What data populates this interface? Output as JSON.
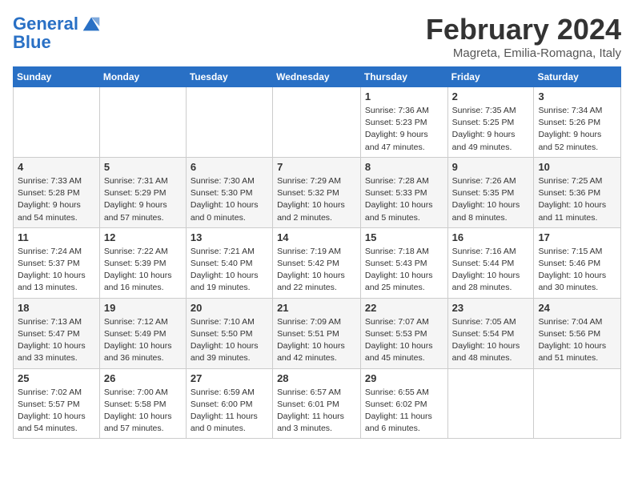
{
  "header": {
    "logo_general": "General",
    "logo_blue": "Blue",
    "month_title": "February 2024",
    "subtitle": "Magreta, Emilia-Romagna, Italy"
  },
  "columns": [
    "Sunday",
    "Monday",
    "Tuesday",
    "Wednesday",
    "Thursday",
    "Friday",
    "Saturday"
  ],
  "weeks": [
    [
      {
        "day": "",
        "info": ""
      },
      {
        "day": "",
        "info": ""
      },
      {
        "day": "",
        "info": ""
      },
      {
        "day": "",
        "info": ""
      },
      {
        "day": "1",
        "info": "Sunrise: 7:36 AM\nSunset: 5:23 PM\nDaylight: 9 hours\nand 47 minutes."
      },
      {
        "day": "2",
        "info": "Sunrise: 7:35 AM\nSunset: 5:25 PM\nDaylight: 9 hours\nand 49 minutes."
      },
      {
        "day": "3",
        "info": "Sunrise: 7:34 AM\nSunset: 5:26 PM\nDaylight: 9 hours\nand 52 minutes."
      }
    ],
    [
      {
        "day": "4",
        "info": "Sunrise: 7:33 AM\nSunset: 5:28 PM\nDaylight: 9 hours\nand 54 minutes."
      },
      {
        "day": "5",
        "info": "Sunrise: 7:31 AM\nSunset: 5:29 PM\nDaylight: 9 hours\nand 57 minutes."
      },
      {
        "day": "6",
        "info": "Sunrise: 7:30 AM\nSunset: 5:30 PM\nDaylight: 10 hours\nand 0 minutes."
      },
      {
        "day": "7",
        "info": "Sunrise: 7:29 AM\nSunset: 5:32 PM\nDaylight: 10 hours\nand 2 minutes."
      },
      {
        "day": "8",
        "info": "Sunrise: 7:28 AM\nSunset: 5:33 PM\nDaylight: 10 hours\nand 5 minutes."
      },
      {
        "day": "9",
        "info": "Sunrise: 7:26 AM\nSunset: 5:35 PM\nDaylight: 10 hours\nand 8 minutes."
      },
      {
        "day": "10",
        "info": "Sunrise: 7:25 AM\nSunset: 5:36 PM\nDaylight: 10 hours\nand 11 minutes."
      }
    ],
    [
      {
        "day": "11",
        "info": "Sunrise: 7:24 AM\nSunset: 5:37 PM\nDaylight: 10 hours\nand 13 minutes."
      },
      {
        "day": "12",
        "info": "Sunrise: 7:22 AM\nSunset: 5:39 PM\nDaylight: 10 hours\nand 16 minutes."
      },
      {
        "day": "13",
        "info": "Sunrise: 7:21 AM\nSunset: 5:40 PM\nDaylight: 10 hours\nand 19 minutes."
      },
      {
        "day": "14",
        "info": "Sunrise: 7:19 AM\nSunset: 5:42 PM\nDaylight: 10 hours\nand 22 minutes."
      },
      {
        "day": "15",
        "info": "Sunrise: 7:18 AM\nSunset: 5:43 PM\nDaylight: 10 hours\nand 25 minutes."
      },
      {
        "day": "16",
        "info": "Sunrise: 7:16 AM\nSunset: 5:44 PM\nDaylight: 10 hours\nand 28 minutes."
      },
      {
        "day": "17",
        "info": "Sunrise: 7:15 AM\nSunset: 5:46 PM\nDaylight: 10 hours\nand 30 minutes."
      }
    ],
    [
      {
        "day": "18",
        "info": "Sunrise: 7:13 AM\nSunset: 5:47 PM\nDaylight: 10 hours\nand 33 minutes."
      },
      {
        "day": "19",
        "info": "Sunrise: 7:12 AM\nSunset: 5:49 PM\nDaylight: 10 hours\nand 36 minutes."
      },
      {
        "day": "20",
        "info": "Sunrise: 7:10 AM\nSunset: 5:50 PM\nDaylight: 10 hours\nand 39 minutes."
      },
      {
        "day": "21",
        "info": "Sunrise: 7:09 AM\nSunset: 5:51 PM\nDaylight: 10 hours\nand 42 minutes."
      },
      {
        "day": "22",
        "info": "Sunrise: 7:07 AM\nSunset: 5:53 PM\nDaylight: 10 hours\nand 45 minutes."
      },
      {
        "day": "23",
        "info": "Sunrise: 7:05 AM\nSunset: 5:54 PM\nDaylight: 10 hours\nand 48 minutes."
      },
      {
        "day": "24",
        "info": "Sunrise: 7:04 AM\nSunset: 5:56 PM\nDaylight: 10 hours\nand 51 minutes."
      }
    ],
    [
      {
        "day": "25",
        "info": "Sunrise: 7:02 AM\nSunset: 5:57 PM\nDaylight: 10 hours\nand 54 minutes."
      },
      {
        "day": "26",
        "info": "Sunrise: 7:00 AM\nSunset: 5:58 PM\nDaylight: 10 hours\nand 57 minutes."
      },
      {
        "day": "27",
        "info": "Sunrise: 6:59 AM\nSunset: 6:00 PM\nDaylight: 11 hours\nand 0 minutes."
      },
      {
        "day": "28",
        "info": "Sunrise: 6:57 AM\nSunset: 6:01 PM\nDaylight: 11 hours\nand 3 minutes."
      },
      {
        "day": "29",
        "info": "Sunrise: 6:55 AM\nSunset: 6:02 PM\nDaylight: 11 hours\nand 6 minutes."
      },
      {
        "day": "",
        "info": ""
      },
      {
        "day": "",
        "info": ""
      }
    ]
  ]
}
